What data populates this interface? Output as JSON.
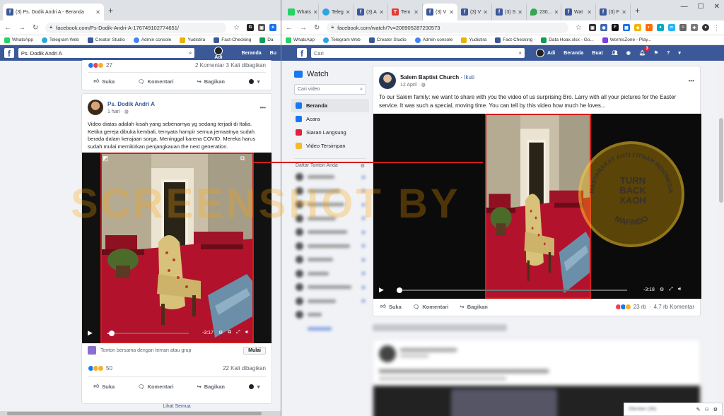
{
  "left_window": {
    "tabs": [
      {
        "title": "(3) Ps. Dodik Andri A - Beranda",
        "active": true
      }
    ],
    "url": "facebook.com/Ps-Dodik-Andri-A-176749102774651/",
    "bookmarks": [
      "WhatsApp",
      "Telegram Web",
      "Creator Studio",
      "Admin console",
      "Yudistira",
      "Fact-Checking",
      "Da"
    ],
    "fb_search": "Ps. Dodik Andri A",
    "fb_user": "Adi",
    "fb_home": "Beranda",
    "fb_more": "Bu",
    "prev_post": {
      "reaction_count": "27",
      "stats": "2 Komentar  3 Kali dibagikan",
      "like": "Suka",
      "comment": "Komentari",
      "share": "Bagikan"
    },
    "post": {
      "author": "Ps. Dodik Andri A",
      "time": "1 hari",
      "text": "Video diatas adalah kisah yang sebenarnya yg sedang terjadi di Italia. Ketika gereja dibuka kembali, ternyata hampir semua jemaatnya sudah berada dalam kerajaan sorga. Meninggal karena COVID. Mereka harus sudah mulai memikirkan penjangkauan the next generation.",
      "video_time": "-3:17",
      "video_progress": 0.05,
      "watch_party_text": "Tonton bersama dengan teman atau grup",
      "watch_party_button": "Mulai",
      "reaction_count": "50",
      "shares": "22 Kali dibagikan",
      "like": "Suka",
      "comment": "Komentari",
      "share": "Bagikan"
    },
    "see_all": "Lihat Semua"
  },
  "right_window": {
    "tabs": [
      {
        "title": "Whats"
      },
      {
        "title": "Teleg"
      },
      {
        "title": "(3) A"
      },
      {
        "title": "Tem"
      },
      {
        "title": "(3) V",
        "active": true
      },
      {
        "title": "(3) V"
      },
      {
        "title": "(3) S"
      },
      {
        "title": "230..."
      },
      {
        "title": "Wat"
      },
      {
        "title": "(3) F"
      }
    ],
    "url": "facebook.com/watch/?v=208905287200573",
    "bookmarks": [
      "WhatsApp",
      "Telegram Web",
      "Creator Studio",
      "Admin console",
      "Yudistira",
      "Fact-Checking",
      "Data Hoax.xlsx - Go...",
      "WormsZone - Play..."
    ],
    "fb_search_placeholder": "Cari",
    "fb_user": "Adi",
    "fb_home": "Beranda",
    "fb_create": "Buat",
    "notif_count": "3",
    "sidebar": {
      "title": "Watch",
      "search_placeholder": "Cari video",
      "items": [
        {
          "label": "Beranda",
          "color": "#1877f2"
        },
        {
          "label": "Acara",
          "color": "#1877f2"
        },
        {
          "label": "Siaran Langsung",
          "color": "#e41e3f"
        },
        {
          "label": "Video Tersimpan",
          "color": "#f7b928"
        }
      ],
      "list_title": "Daftar Tonton Anda"
    },
    "post": {
      "author": "Salem Baptist Church",
      "follow": "Ikuti",
      "date": "12 April",
      "text": "To our Salem family: we want to share with you the video of us surprising Bro. Larry with all your pictures for the Easter service. It was such a special, moving time. You can tell by this video how much he loves...",
      "video_time": "-3:18",
      "video_progress": 0.01,
      "like": "Suka",
      "comment": "Komentari",
      "share": "Bagikan",
      "reactions": "23 rb",
      "comments": "4,7 rb Komentar"
    },
    "chat_label": "Obrolan (36)"
  },
  "watermark": {
    "text": "SCREENSHOT BY",
    "seal_top": "MASYARAKAT ANTI FITNAH INDONESIA",
    "seal_center": [
      "TURN",
      "BACK",
      "HOAX"
    ],
    "seal_bottom": "MAFINDO"
  },
  "colors": {
    "fb_blue": "#3b5998",
    "highlight_red": "#d01d1d",
    "carpet": "#b3122c"
  }
}
